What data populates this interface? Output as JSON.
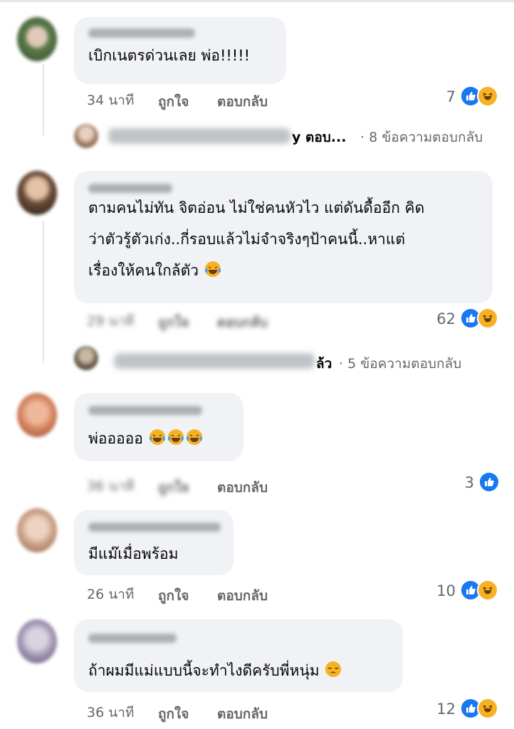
{
  "comments": [
    {
      "text_lines": [
        "เบิกเนตรด่วนเลย พ่อ!!!!!"
      ],
      "time": "34 นาที",
      "like_label": "ถูกใจ",
      "reply_label": "ตอบกลับ",
      "reaction_count": "7",
      "reactions": [
        "like",
        "haha"
      ],
      "replies_preview": {
        "suffix": "y ตอบ...",
        "count_text": "· 8 ข้อความตอบกลับ"
      }
    },
    {
      "text_lines": [
        "ตามคนไม่ทัน จิตอ่อน ไม่ใช่คนหัวไว แต่ดันดื้ออีก คิด",
        "ว่าตัวรู้ตัวเก่ง..กี่รอบแล้วไม่จำจริงๆป้าคนนี้..หาแต่",
        "เรื่องให้คนใกล้ตัว"
      ],
      "time": "29 นาที",
      "like_label": "ถูกใจ",
      "reply_label": "ตอบกลับ",
      "reaction_count": "62",
      "reactions": [
        "like",
        "haha"
      ],
      "replies_preview": {
        "suffix": "ล้ว",
        "count_text": "· 5 ข้อความตอบกลับ"
      }
    },
    {
      "text_lines": [
        "พ่อออออ"
      ],
      "time": "36 นาที",
      "like_label": "ถูกใจ",
      "reply_label": "ตอบกลับ",
      "reaction_count": "3",
      "reactions": [
        "like"
      ]
    },
    {
      "text_lines": [
        "มีแม๊เมื่อพร้อม"
      ],
      "time": "26 นาที",
      "like_label": "ถูกใจ",
      "reply_label": "ตอบกลับ",
      "reaction_count": "10",
      "reactions": [
        "like",
        "haha"
      ]
    },
    {
      "text_lines": [
        "ถ้าผมมีแม่แบบนี้จะทำไงดีครับพี่หนุ่ม"
      ],
      "time": "36 นาที",
      "like_label": "ถูกใจ",
      "reply_label": "ตอบกลับ",
      "reaction_count": "12",
      "reactions": [
        "like",
        "haha"
      ]
    }
  ],
  "colors": {
    "like": "#1877f2",
    "haha": "#f7b125",
    "bubble": "#f0f2f5",
    "meta": "#65676b"
  },
  "icons": {
    "like": "thumbs-up-icon",
    "haha": "laughing-face-icon",
    "tears": "tears-of-joy-icon",
    "pensive": "pensive-face-icon"
  }
}
